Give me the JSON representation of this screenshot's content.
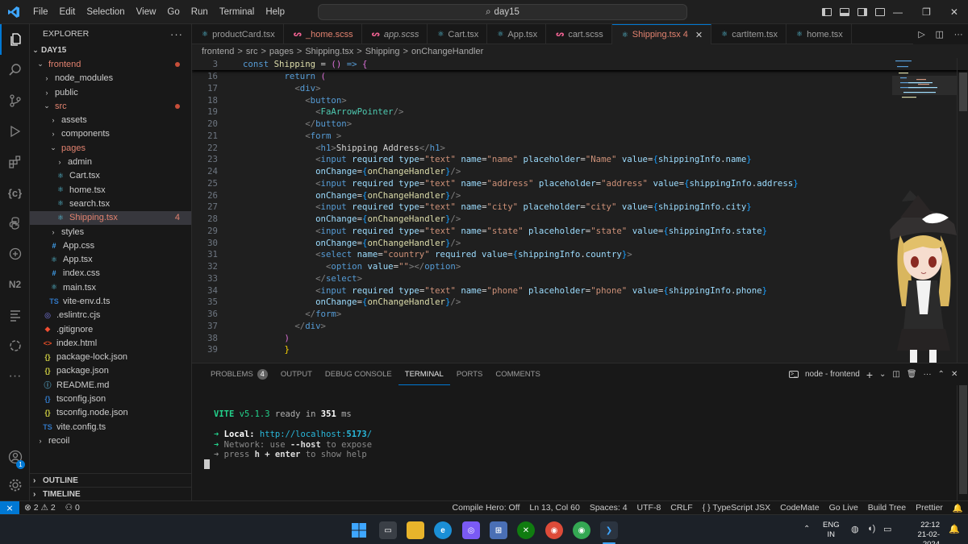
{
  "menu": [
    "File",
    "Edit",
    "Selection",
    "View",
    "Go",
    "Run",
    "Terminal",
    "Help"
  ],
  "search": "day15",
  "explorer": {
    "title": "EXPLORER",
    "workspace": "DAY15",
    "items": [
      {
        "label": "frontend",
        "kind": "folder-open",
        "depth": 0,
        "dot": true,
        "red": true
      },
      {
        "label": "node_modules",
        "kind": "folder",
        "depth": 1
      },
      {
        "label": "public",
        "kind": "folder",
        "depth": 1
      },
      {
        "label": "src",
        "kind": "folder-open",
        "depth": 1,
        "dot": true,
        "red": true
      },
      {
        "label": "assets",
        "kind": "folder",
        "depth": 2
      },
      {
        "label": "components",
        "kind": "folder",
        "depth": 2
      },
      {
        "label": "pages",
        "kind": "folder-open",
        "depth": 2,
        "red": true
      },
      {
        "label": "admin",
        "kind": "folder",
        "depth": 3
      },
      {
        "label": "Cart.tsx",
        "kind": "react",
        "depth": 3
      },
      {
        "label": "home.tsx",
        "kind": "react",
        "depth": 3
      },
      {
        "label": "search.tsx",
        "kind": "react",
        "depth": 3
      },
      {
        "label": "Shipping.tsx",
        "kind": "react",
        "depth": 3,
        "badge": "4",
        "sel": true,
        "red": true
      },
      {
        "label": "styles",
        "kind": "folder",
        "depth": 2
      },
      {
        "label": "App.css",
        "kind": "css",
        "depth": 2
      },
      {
        "label": "App.tsx",
        "kind": "react",
        "depth": 2
      },
      {
        "label": "index.css",
        "kind": "css",
        "depth": 2
      },
      {
        "label": "main.tsx",
        "kind": "react",
        "depth": 2
      },
      {
        "label": "vite-env.d.ts",
        "kind": "ts",
        "depth": 2
      },
      {
        "label": ".eslintrc.cjs",
        "kind": "eslint",
        "depth": 1
      },
      {
        "label": ".gitignore",
        "kind": "git",
        "depth": 1
      },
      {
        "label": "index.html",
        "kind": "html",
        "depth": 1
      },
      {
        "label": "package-lock.json",
        "kind": "json",
        "depth": 1
      },
      {
        "label": "package.json",
        "kind": "json",
        "depth": 1
      },
      {
        "label": "README.md",
        "kind": "info",
        "depth": 1
      },
      {
        "label": "tsconfig.json",
        "kind": "tsconfig",
        "depth": 1
      },
      {
        "label": "tsconfig.node.json",
        "kind": "json",
        "depth": 1
      },
      {
        "label": "vite.config.ts",
        "kind": "ts",
        "depth": 1
      },
      {
        "label": "recoil",
        "kind": "folder",
        "depth": 0
      }
    ],
    "outline": "OUTLINE",
    "timeline": "TIMELINE"
  },
  "tabs": [
    {
      "label": "productCard.tsx",
      "kind": "react"
    },
    {
      "label": "_home.scss",
      "kind": "scss",
      "mod": true
    },
    {
      "label": "app.scss",
      "kind": "scss",
      "italic": true
    },
    {
      "label": "Cart.tsx",
      "kind": "react"
    },
    {
      "label": "App.tsx",
      "kind": "react"
    },
    {
      "label": "cart.scss",
      "kind": "scss"
    },
    {
      "label": "Shipping.tsx 4",
      "kind": "react",
      "active": true
    },
    {
      "label": "cartItem.tsx",
      "kind": "react"
    },
    {
      "label": "home.tsx",
      "kind": "react"
    }
  ],
  "breadcrumb": [
    "frontend",
    ">",
    "src",
    ">",
    "pages",
    ">",
    "Shipping.tsx",
    ">",
    "Shipping",
    ">",
    "onChangeHandler"
  ],
  "code": {
    "sticky": {
      "n": "3",
      "text": "const Shipping = () => {"
    },
    "lines": [
      {
        "n": "15",
        "html": "<span class='br2'>}</span>"
      },
      {
        "n": "16",
        "html": "<span class='kw'>return</span> <span class='br2'>(</span>"
      },
      {
        "n": "17",
        "html": "  <span class='pun'>&lt;</span><span class='tag'>div</span><span class='pun'>&gt;</span>"
      },
      {
        "n": "18",
        "html": "    <span class='pun'>&lt;</span><span class='tag'>button</span><span class='pun'>&gt;</span>"
      },
      {
        "n": "19",
        "html": "      <span class='pun'>&lt;</span><span class='comp'>FaArrowPointer</span><span class='pun'>/&gt;</span>"
      },
      {
        "n": "20",
        "html": "    <span class='pun'>&lt;/</span><span class='tag'>button</span><span class='pun'>&gt;</span>"
      },
      {
        "n": "21",
        "html": "    <span class='pun'>&lt;</span><span class='tag'>form</span> <span class='pun'>&gt;</span>"
      },
      {
        "n": "22",
        "html": "      <span class='pun'>&lt;</span><span class='tag'>h1</span><span class='pun'>&gt;</span>Shipping Address<span class='pun'>&lt;/</span><span class='tag'>h1</span><span class='pun'>&gt;</span>"
      },
      {
        "n": "23",
        "html": "      <span class='pun'>&lt;</span><span class='tag'>input</span> <span class='attr'>required</span> <span class='attr'>type</span>=<span class='str'>\"text\"</span> <span class='attr'>name</span>=<span class='str'>\"name\"</span> <span class='attr'>placeholder</span>=<span class='str'>\"Name\"</span> <span class='attr'>value</span>=<span class='br3'>{</span><span class='var'>shippingInfo</span>.<span class='var'>name</span><span class='br3'>}</span>"
      },
      {
        "n": "24",
        "html": "      <span class='attr'>onChange</span>=<span class='br3'>{</span><span class='fn'>onChangeHandler</span><span class='br3'>}</span><span class='pun'>/&gt;</span>"
      },
      {
        "n": "25",
        "html": "      <span class='pun'>&lt;</span><span class='tag'>input</span> <span class='attr'>required</span> <span class='attr'>type</span>=<span class='str'>\"text\"</span> <span class='attr'>name</span>=<span class='str'>\"address\"</span> <span class='attr'>placeholder</span>=<span class='str'>\"address\"</span> <span class='attr'>value</span>=<span class='br3'>{</span><span class='var'>shippingInfo</span>.<span class='var'>address</span><span class='br3'>}</span>"
      },
      {
        "n": "26",
        "html": "      <span class='attr'>onChange</span>=<span class='br3'>{</span><span class='fn'>onChangeHandler</span><span class='br3'>}</span><span class='pun'>/&gt;</span>"
      },
      {
        "n": "27",
        "html": "      <span class='pun'>&lt;</span><span class='tag'>input</span> <span class='attr'>required</span> <span class='attr'>type</span>=<span class='str'>\"text\"</span> <span class='attr'>name</span>=<span class='str'>\"city\"</span> <span class='attr'>placeholder</span>=<span class='str'>\"city\"</span> <span class='attr'>value</span>=<span class='br3'>{</span><span class='var'>shippingInfo</span>.<span class='var'>city</span><span class='br3'>}</span>"
      },
      {
        "n": "28",
        "html": "      <span class='attr'>onChange</span>=<span class='br3'>{</span><span class='fn'>onChangeHandler</span><span class='br3'>}</span><span class='pun'>/&gt;</span>"
      },
      {
        "n": "29",
        "html": "      <span class='pun'>&lt;</span><span class='tag'>input</span> <span class='attr'>required</span> <span class='attr'>type</span>=<span class='str'>\"text\"</span> <span class='attr'>name</span>=<span class='str'>\"state\"</span> <span class='attr'>placeholder</span>=<span class='str'>\"state\"</span> <span class='attr'>value</span>=<span class='br3'>{</span><span class='var'>shippingInfo</span>.<span class='var'>state</span><span class='br3'>}</span>"
      },
      {
        "n": "30",
        "html": "      <span class='attr'>onChange</span>=<span class='br3'>{</span><span class='fn'>onChangeHandler</span><span class='br3'>}</span><span class='pun'>/&gt;</span>"
      },
      {
        "n": "31",
        "html": "      <span class='pun'>&lt;</span><span class='tag'>select</span> <span class='attr'>name</span>=<span class='str'>\"country\"</span> <span class='attr'>required</span> <span class='attr'>value</span>=<span class='br3'>{</span><span class='var'>shippingInfo</span>.<span class='var'>country</span><span class='br3'>}</span><span class='pun'>&gt;</span>"
      },
      {
        "n": "32",
        "html": "        <span class='pun'>&lt;</span><span class='tag'>option</span> <span class='attr'>value</span>=<span class='str'>\"\"</span><span class='pun'>&gt;&lt;/</span><span class='tag'>option</span><span class='pun'>&gt;</span>"
      },
      {
        "n": "33",
        "html": "      <span class='pun'>&lt;/</span><span class='tag'>select</span><span class='pun'>&gt;</span>"
      },
      {
        "n": "34",
        "html": "      <span class='pun'>&lt;</span><span class='tag'>input</span> <span class='attr'>required</span> <span class='attr'>type</span>=<span class='str'>\"text\"</span> <span class='attr'>name</span>=<span class='str'>\"phone\"</span> <span class='attr'>placeholder</span>=<span class='str'>\"phone\"</span> <span class='attr'>value</span>=<span class='br3'>{</span><span class='var'>shippingInfo</span>.<span class='var'>phone</span><span class='br3'>}</span>"
      },
      {
        "n": "35",
        "html": "      <span class='attr'>onChange</span>=<span class='br3'>{</span><span class='fn'>onChangeHandler</span><span class='br3'>}</span><span class='pun'>/&gt;</span>"
      },
      {
        "n": "36",
        "html": "    <span class='pun'>&lt;/</span><span class='tag'>form</span><span class='pun'>&gt;</span>"
      },
      {
        "n": "37",
        "html": "  <span class='pun'>&lt;/</span><span class='tag'>div</span><span class='pun'>&gt;</span>"
      },
      {
        "n": "38",
        "html": "<span class='br2'>)</span>"
      },
      {
        "n": "39",
        "html": "<span class='br'>}</span>"
      }
    ]
  },
  "panel": {
    "tabs": [
      "PROBLEMS",
      "OUTPUT",
      "DEBUG CONSOLE",
      "TERMINAL",
      "PORTS",
      "COMMENTS"
    ],
    "problems_count": "4",
    "terminal_name": "node - frontend",
    "vite": "VITE",
    "vite_ver": "v5.1.3",
    "ready": "ready in",
    "ms": "351",
    "ms_unit": "ms",
    "local_label": "Local:",
    "local_url_a": "http://localhost:",
    "local_port": "5173",
    "local_url_b": "/",
    "net_label": "Network:",
    "net_a": "use",
    "net_b": "--host",
    "net_c": "to expose",
    "help_a": "press",
    "help_b": "h + enter",
    "help_c": "to show help"
  },
  "status": {
    "errors": "2",
    "warnings": "2",
    "ports": "0",
    "items": [
      "Compile Hero: Off",
      "Ln 13, Col 60",
      "Spaces: 4",
      "UTF-8",
      "CRLF",
      "{ } TypeScript JSX",
      "CodeMate",
      "Go Live",
      "Build Tree",
      "Prettier"
    ]
  },
  "taskbar": {
    "lang1": "ENG",
    "lang2": "IN",
    "time": "22:12",
    "date": "21-02-2024"
  },
  "colors": {
    "accent": "#0078d4",
    "modified": "#e2826f",
    "dot": "#c74e39"
  }
}
